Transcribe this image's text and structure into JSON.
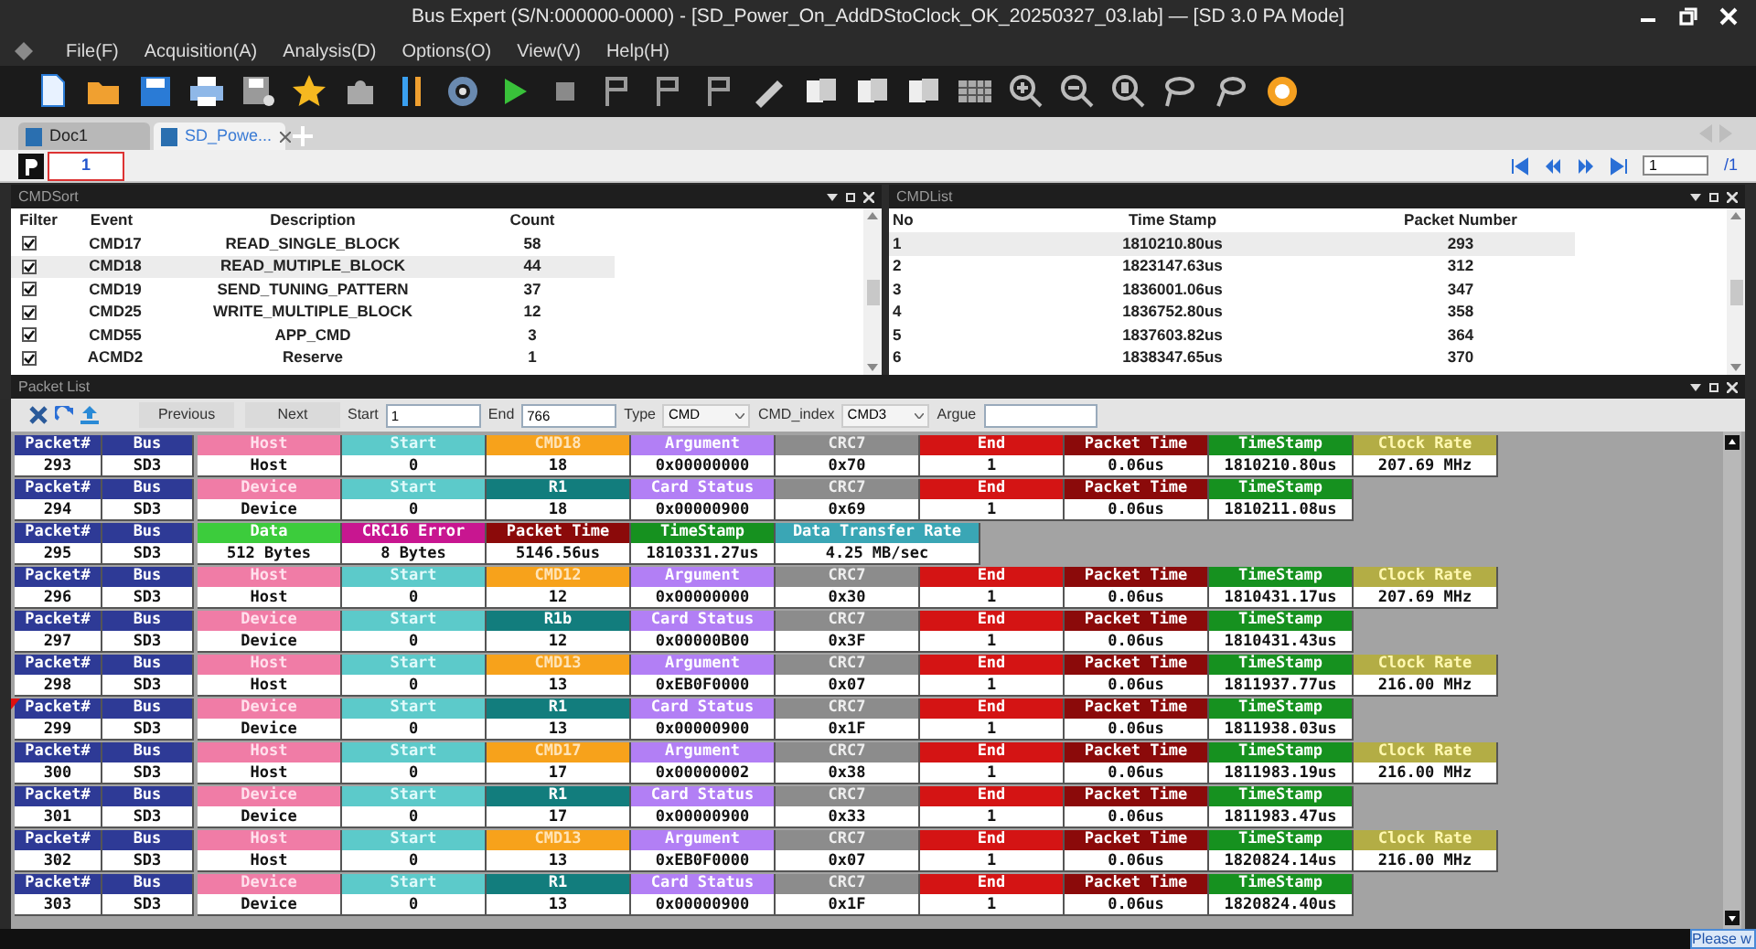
{
  "window": {
    "title": "Bus Expert (S/N:000000-0000) - [SD_Power_On_AddDStoClock_OK_20250327_03.lab] — [SD 3.0 PA Mode]"
  },
  "menu": [
    "File(F)",
    "Acquisition(A)",
    "Analysis(D)",
    "Options(O)",
    "View(V)",
    "Help(H)"
  ],
  "doc_tabs": [
    {
      "label": "Doc1",
      "selected": false
    },
    {
      "label": "SD_Powe...",
      "selected": true
    }
  ],
  "page_tabs": [
    {
      "label": "1",
      "selected": true
    }
  ],
  "pager": {
    "page": "1",
    "total": "/1"
  },
  "cmd_sort": {
    "title": "CMDSort",
    "columns": [
      "Filter",
      "Event",
      "Description",
      "Count"
    ],
    "rows": [
      {
        "checked": true,
        "selected": false,
        "event": "CMD17",
        "description": "READ_SINGLE_BLOCK",
        "count": "58"
      },
      {
        "checked": true,
        "selected": true,
        "event": "CMD18",
        "description": "READ_MUTIPLE_BLOCK",
        "count": "44"
      },
      {
        "checked": true,
        "selected": false,
        "event": "CMD19",
        "description": "SEND_TUNING_PATTERN",
        "count": "37"
      },
      {
        "checked": true,
        "selected": false,
        "event": "CMD25",
        "description": "WRITE_MULTIPLE_BLOCK",
        "count": "12"
      },
      {
        "checked": true,
        "selected": false,
        "event": "CMD55",
        "description": "APP_CMD",
        "count": "3"
      },
      {
        "checked": true,
        "selected": false,
        "event": "ACMD2",
        "description": "Reserve",
        "count": "1"
      }
    ]
  },
  "cmd_list": {
    "title": "CMDList",
    "columns": [
      "No",
      "Time Stamp",
      "Packet Number"
    ],
    "rows": [
      {
        "selected": true,
        "no": "1",
        "time": "1810210.80us",
        "packet": "293"
      },
      {
        "selected": false,
        "no": "2",
        "time": "1823147.63us",
        "packet": "312"
      },
      {
        "selected": false,
        "no": "3",
        "time": "1836001.06us",
        "packet": "347"
      },
      {
        "selected": false,
        "no": "4",
        "time": "1836752.80us",
        "packet": "358"
      },
      {
        "selected": false,
        "no": "5",
        "time": "1837603.82us",
        "packet": "364"
      },
      {
        "selected": false,
        "no": "6",
        "time": "1838347.65us",
        "packet": "370"
      }
    ]
  },
  "packet_list": {
    "title": "Packet List",
    "toolbar": {
      "previous": "Previous",
      "next": "Next",
      "start_label": "Start",
      "start": "1",
      "end_label": "End",
      "end": "766",
      "type_label": "Type",
      "type": "CMD",
      "index_label": "CMD_index",
      "index": "CMD3",
      "argue_label": "Argue"
    },
    "packets": [
      {
        "flagged": false,
        "fields": [
          {
            "kind": "pnum",
            "label": "Packet#",
            "value": "293"
          },
          {
            "kind": "bus",
            "label": "Bus",
            "value": "SD3"
          },
          {
            "kind": "dir",
            "label": "Host",
            "value": "Host"
          },
          {
            "kind": "start",
            "label": "Start",
            "value": "0"
          },
          {
            "kind": "cmd",
            "label": "CMD18",
            "value": "18"
          },
          {
            "kind": "arg",
            "label": "Argument",
            "value": "0x00000000"
          },
          {
            "kind": "crc",
            "label": "CRC7",
            "value": "0x70"
          },
          {
            "kind": "end",
            "label": "End",
            "value": "1"
          },
          {
            "kind": "ptime",
            "label": "Packet Time",
            "value": "0.06us"
          },
          {
            "kind": "ts",
            "label": "TimeStamp",
            "value": "1810210.80us"
          },
          {
            "kind": "clock",
            "label": "Clock Rate",
            "value": "207.69 MHz"
          }
        ]
      },
      {
        "flagged": false,
        "fields": [
          {
            "kind": "pnum",
            "label": "Packet#",
            "value": "294"
          },
          {
            "kind": "bus",
            "label": "Bus",
            "value": "SD3"
          },
          {
            "kind": "dir",
            "label": "Device",
            "value": "Device"
          },
          {
            "kind": "start",
            "label": "Start",
            "value": "0"
          },
          {
            "kind": "resp",
            "label": "R1",
            "value": "18"
          },
          {
            "kind": "arg",
            "label": "Card Status",
            "value": "0x00000900"
          },
          {
            "kind": "crc",
            "label": "CRC7",
            "value": "0x69"
          },
          {
            "kind": "end",
            "label": "End",
            "value": "1"
          },
          {
            "kind": "ptime",
            "label": "Packet Time",
            "value": "0.06us"
          },
          {
            "kind": "ts",
            "label": "TimeStamp",
            "value": "1810211.08us"
          }
        ]
      },
      {
        "flagged": false,
        "fields": [
          {
            "kind": "pnum",
            "label": "Packet#",
            "value": "295"
          },
          {
            "kind": "bus",
            "label": "Bus",
            "value": "SD3"
          },
          {
            "kind": "data",
            "label": "Data",
            "value": "512 Bytes"
          },
          {
            "kind": "crcerr",
            "label": "CRC16 Error",
            "value": "8 Bytes"
          },
          {
            "kind": "ptime",
            "label": "Packet Time",
            "value": "5146.56us"
          },
          {
            "kind": "ts",
            "label": "TimeStamp",
            "value": "1810331.27us"
          },
          {
            "kind": "rate",
            "label": "Data Transfer Rate",
            "value": "4.25 MB/sec"
          }
        ]
      },
      {
        "flagged": false,
        "fields": [
          {
            "kind": "pnum",
            "label": "Packet#",
            "value": "296"
          },
          {
            "kind": "bus",
            "label": "Bus",
            "value": "SD3"
          },
          {
            "kind": "dir",
            "label": "Host",
            "value": "Host"
          },
          {
            "kind": "start",
            "label": "Start",
            "value": "0"
          },
          {
            "kind": "cmd",
            "label": "CMD12",
            "value": "12"
          },
          {
            "kind": "arg",
            "label": "Argument",
            "value": "0x00000000"
          },
          {
            "kind": "crc",
            "label": "CRC7",
            "value": "0x30"
          },
          {
            "kind": "end",
            "label": "End",
            "value": "1"
          },
          {
            "kind": "ptime",
            "label": "Packet Time",
            "value": "0.06us"
          },
          {
            "kind": "ts",
            "label": "TimeStamp",
            "value": "1810431.17us"
          },
          {
            "kind": "clock",
            "label": "Clock Rate",
            "value": "207.69 MHz"
          }
        ]
      },
      {
        "flagged": false,
        "fields": [
          {
            "kind": "pnum",
            "label": "Packet#",
            "value": "297"
          },
          {
            "kind": "bus",
            "label": "Bus",
            "value": "SD3"
          },
          {
            "kind": "dir",
            "label": "Device",
            "value": "Device"
          },
          {
            "kind": "start",
            "label": "Start",
            "value": "0"
          },
          {
            "kind": "resp",
            "label": "R1b",
            "value": "12"
          },
          {
            "kind": "arg",
            "label": "Card Status",
            "value": "0x00000B00"
          },
          {
            "kind": "crc",
            "label": "CRC7",
            "value": "0x3F"
          },
          {
            "kind": "end",
            "label": "End",
            "value": "1"
          },
          {
            "kind": "ptime",
            "label": "Packet Time",
            "value": "0.06us"
          },
          {
            "kind": "ts",
            "label": "TimeStamp",
            "value": "1810431.43us"
          }
        ]
      },
      {
        "flagged": false,
        "fields": [
          {
            "kind": "pnum",
            "label": "Packet#",
            "value": "298"
          },
          {
            "kind": "bus",
            "label": "Bus",
            "value": "SD3"
          },
          {
            "kind": "dir",
            "label": "Host",
            "value": "Host"
          },
          {
            "kind": "start",
            "label": "Start",
            "value": "0"
          },
          {
            "kind": "cmd",
            "label": "CMD13",
            "value": "13"
          },
          {
            "kind": "arg",
            "label": "Argument",
            "value": "0xEB0F0000"
          },
          {
            "kind": "crc",
            "label": "CRC7",
            "value": "0x07"
          },
          {
            "kind": "end",
            "label": "End",
            "value": "1"
          },
          {
            "kind": "ptime",
            "label": "Packet Time",
            "value": "0.06us"
          },
          {
            "kind": "ts",
            "label": "TimeStamp",
            "value": "1811937.77us"
          },
          {
            "kind": "clock",
            "label": "Clock Rate",
            "value": "216.00 MHz"
          }
        ]
      },
      {
        "flagged": true,
        "fields": [
          {
            "kind": "pnum",
            "label": "Packet#",
            "value": "299"
          },
          {
            "kind": "bus",
            "label": "Bus",
            "value": "SD3"
          },
          {
            "kind": "dir",
            "label": "Device",
            "value": "Device"
          },
          {
            "kind": "start",
            "label": "Start",
            "value": "0"
          },
          {
            "kind": "resp",
            "label": "R1",
            "value": "13"
          },
          {
            "kind": "arg",
            "label": "Card Status",
            "value": "0x00000900"
          },
          {
            "kind": "crc",
            "label": "CRC7",
            "value": "0x1F"
          },
          {
            "kind": "end",
            "label": "End",
            "value": "1"
          },
          {
            "kind": "ptime",
            "label": "Packet Time",
            "value": "0.06us"
          },
          {
            "kind": "ts",
            "label": "TimeStamp",
            "value": "1811938.03us"
          }
        ]
      },
      {
        "flagged": false,
        "fields": [
          {
            "kind": "pnum",
            "label": "Packet#",
            "value": "300"
          },
          {
            "kind": "bus",
            "label": "Bus",
            "value": "SD3"
          },
          {
            "kind": "dir",
            "label": "Host",
            "value": "Host"
          },
          {
            "kind": "start",
            "label": "Start",
            "value": "0"
          },
          {
            "kind": "cmd",
            "label": "CMD17",
            "value": "17"
          },
          {
            "kind": "arg",
            "label": "Argument",
            "value": "0x00000002"
          },
          {
            "kind": "crc",
            "label": "CRC7",
            "value": "0x38"
          },
          {
            "kind": "end",
            "label": "End",
            "value": "1"
          },
          {
            "kind": "ptime",
            "label": "Packet Time",
            "value": "0.06us"
          },
          {
            "kind": "ts",
            "label": "TimeStamp",
            "value": "1811983.19us"
          },
          {
            "kind": "clock",
            "label": "Clock Rate",
            "value": "216.00 MHz"
          }
        ]
      },
      {
        "flagged": false,
        "fields": [
          {
            "kind": "pnum",
            "label": "Packet#",
            "value": "301"
          },
          {
            "kind": "bus",
            "label": "Bus",
            "value": "SD3"
          },
          {
            "kind": "dir",
            "label": "Device",
            "value": "Device"
          },
          {
            "kind": "start",
            "label": "Start",
            "value": "0"
          },
          {
            "kind": "resp",
            "label": "R1",
            "value": "17"
          },
          {
            "kind": "arg",
            "label": "Card Status",
            "value": "0x00000900"
          },
          {
            "kind": "crc",
            "label": "CRC7",
            "value": "0x33"
          },
          {
            "kind": "end",
            "label": "End",
            "value": "1"
          },
          {
            "kind": "ptime",
            "label": "Packet Time",
            "value": "0.06us"
          },
          {
            "kind": "ts",
            "label": "TimeStamp",
            "value": "1811983.47us"
          }
        ]
      },
      {
        "flagged": false,
        "fields": [
          {
            "kind": "pnum",
            "label": "Packet#",
            "value": "302"
          },
          {
            "kind": "bus",
            "label": "Bus",
            "value": "SD3"
          },
          {
            "kind": "dir",
            "label": "Host",
            "value": "Host"
          },
          {
            "kind": "start",
            "label": "Start",
            "value": "0"
          },
          {
            "kind": "cmd",
            "label": "CMD13",
            "value": "13"
          },
          {
            "kind": "arg",
            "label": "Argument",
            "value": "0xEB0F0000"
          },
          {
            "kind": "crc",
            "label": "CRC7",
            "value": "0x07"
          },
          {
            "kind": "end",
            "label": "End",
            "value": "1"
          },
          {
            "kind": "ptime",
            "label": "Packet Time",
            "value": "0.06us"
          },
          {
            "kind": "ts",
            "label": "TimeStamp",
            "value": "1820824.14us"
          },
          {
            "kind": "clock",
            "label": "Clock Rate",
            "value": "216.00 MHz"
          }
        ]
      },
      {
        "flagged": false,
        "fields": [
          {
            "kind": "pnum",
            "label": "Packet#",
            "value": "303"
          },
          {
            "kind": "bus",
            "label": "Bus",
            "value": "SD3"
          },
          {
            "kind": "dir",
            "label": "Device",
            "value": "Device"
          },
          {
            "kind": "start",
            "label": "Start",
            "value": "0"
          },
          {
            "kind": "resp",
            "label": "R1",
            "value": "13"
          },
          {
            "kind": "arg",
            "label": "Card Status",
            "value": "0x00000900"
          },
          {
            "kind": "crc",
            "label": "CRC7",
            "value": "0x1F"
          },
          {
            "kind": "end",
            "label": "End",
            "value": "1"
          },
          {
            "kind": "ptime",
            "label": "Packet Time",
            "value": "0.06us"
          },
          {
            "kind": "ts",
            "label": "TimeStamp",
            "value": "1820824.40us"
          }
        ]
      }
    ]
  },
  "status_bar": {
    "message": "Please w"
  }
}
